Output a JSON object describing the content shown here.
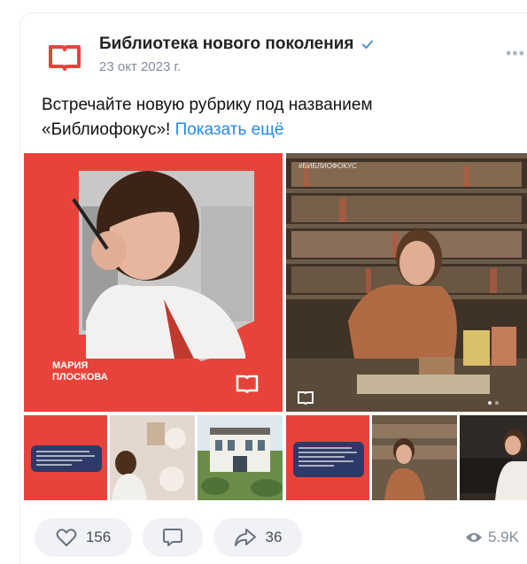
{
  "post": {
    "author": "Библиотека нового поколения",
    "date": "23 окт 2023 г.",
    "text_line1": "Встречайте новую рубрику под названием",
    "text_line2": "«Библиофокус»!",
    "show_more": "Показать ещё"
  },
  "photo_main": {
    "name_line1": "МАРИЯ",
    "name_line2": "ПЛОСКОВА"
  },
  "photo_right": {
    "tag": "#БИБЛИОФОКУС"
  },
  "actions": {
    "likes": "156",
    "reposts": "36",
    "views": "5.9K"
  },
  "colors": {
    "brand_red": "#e8433a",
    "link_blue": "#2688eb",
    "muted": "#818c99"
  },
  "icons": [
    "book-logo-icon",
    "verified-icon",
    "more-icon",
    "heart-icon",
    "comment-icon",
    "share-icon",
    "eye-icon"
  ]
}
